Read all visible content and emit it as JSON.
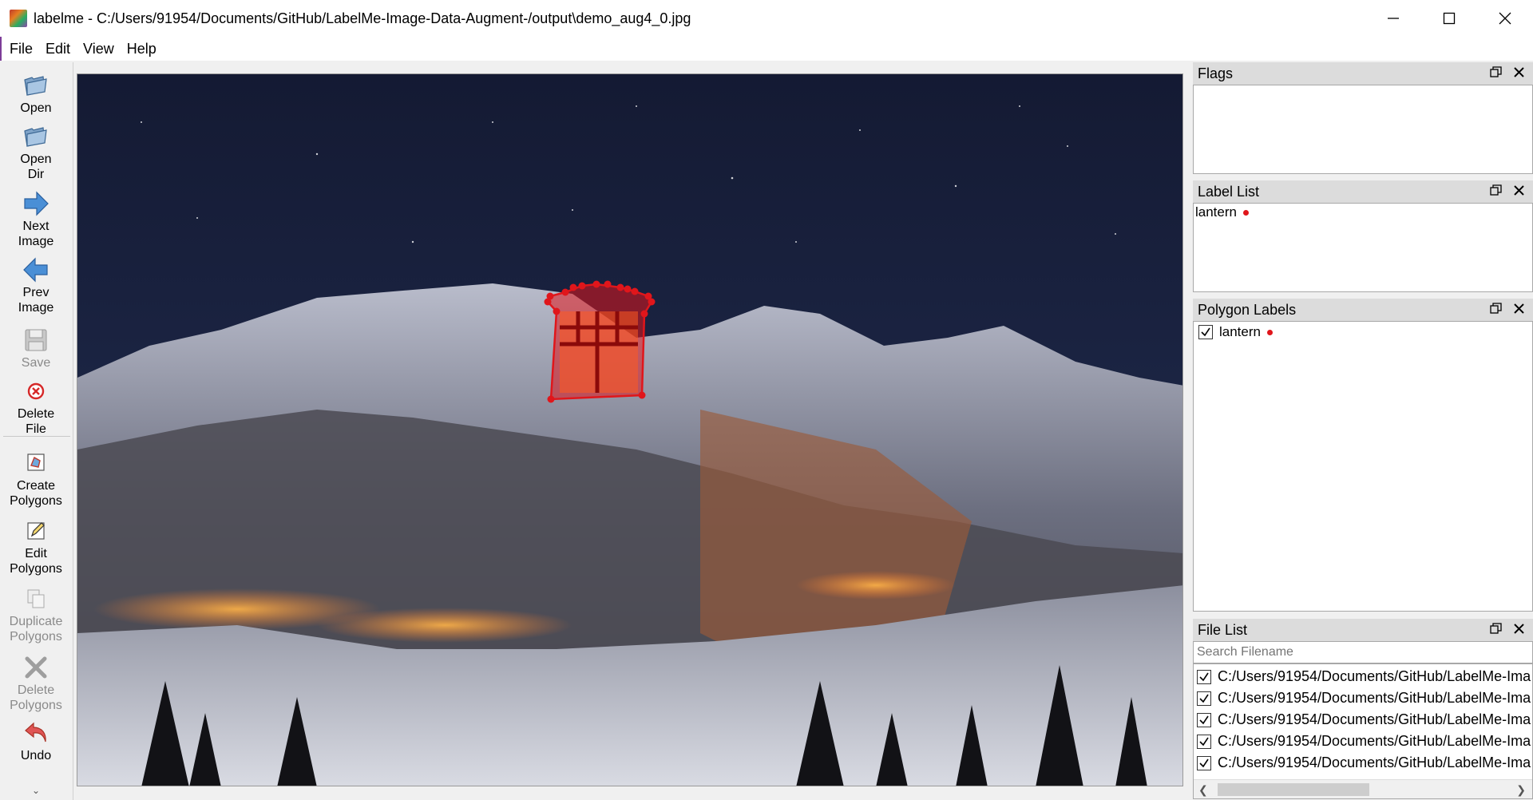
{
  "window": {
    "title": "labelme - C:/Users/91954/Documents/GitHub/LabelMe-Image-Data-Augment-/output\\demo_aug4_0.jpg"
  },
  "menu": [
    "File",
    "Edit",
    "View",
    "Help"
  ],
  "toolbar": {
    "open": "Open",
    "open_dir": [
      "Open",
      "Dir"
    ],
    "next_image": [
      "Next",
      "Image"
    ],
    "prev_image": [
      "Prev",
      "Image"
    ],
    "save": "Save",
    "delete_file": [
      "Delete",
      "File"
    ],
    "create_polygons": [
      "Create",
      "Polygons"
    ],
    "edit_polygons": [
      "Edit",
      "Polygons"
    ],
    "duplicate_polygons": [
      "Duplicate",
      "Polygons"
    ],
    "delete_polygons": [
      "Delete",
      "Polygons"
    ],
    "undo": "Undo"
  },
  "docks": {
    "flags": {
      "title": "Flags"
    },
    "label_list": {
      "title": "Label List",
      "items": [
        {
          "label": "lantern",
          "color": "#e0161b"
        }
      ]
    },
    "polygon_labels": {
      "title": "Polygon Labels",
      "items": [
        {
          "label": "lantern",
          "checked": true,
          "color": "#e0161b"
        }
      ]
    },
    "file_list": {
      "title": "File List",
      "search_placeholder": "Search Filename",
      "files": [
        "C:/Users/91954/Documents/GitHub/LabelMe-Ima",
        "C:/Users/91954/Documents/GitHub/LabelMe-Ima",
        "C:/Users/91954/Documents/GitHub/LabelMe-Ima",
        "C:/Users/91954/Documents/GitHub/LabelMe-Ima",
        "C:/Users/91954/Documents/GitHub/LabelMe-Ima"
      ]
    }
  },
  "colors": {
    "polygon": "#e0161b",
    "title_accent": "#7d3c98"
  }
}
